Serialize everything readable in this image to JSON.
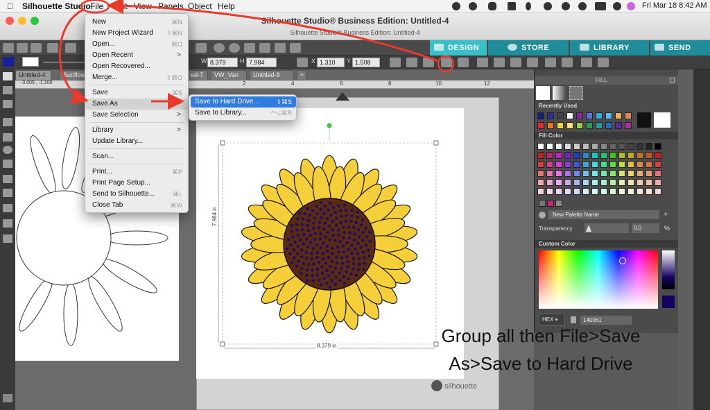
{
  "menubar": {
    "app_name": "Silhouette Studio",
    "items": [
      "File",
      "Edit",
      "View",
      "Panels",
      "Object",
      "Help"
    ],
    "clock": "Fri Mar 18  8:42 AM"
  },
  "window": {
    "title": "Silhouette Studio® Business Edition: Untitled-4",
    "subtitle": "Silhouette Studio® Business Edition: Untitled-4"
  },
  "nav_tabs": [
    {
      "label": "DESIGN",
      "icon": "grid-icon"
    },
    {
      "label": "STORE",
      "icon": "store-icon"
    },
    {
      "label": "LIBRARY",
      "icon": "library-icon"
    },
    {
      "label": "SEND",
      "icon": "send-icon"
    }
  ],
  "toolbar": {
    "w_label": "W",
    "w_value": "8.379",
    "h_label": "H",
    "h_value": "7.984",
    "x_label": "X",
    "x_value": "1.310",
    "y_label": "Y",
    "y_value": "1.508"
  },
  "doc_tabs": [
    "Untitled-4",
    "Sunflow",
    "ed-7",
    "VW_Van",
    "Untitled-8",
    "+"
  ],
  "coords": "-3.005 , -1.100",
  "ruler_marks": [
    "2",
    "4",
    "6",
    "8",
    "10",
    "12"
  ],
  "file_menu": {
    "items": [
      {
        "label": "New",
        "shortcut": "⌘N"
      },
      {
        "label": "New Project Wizard",
        "shortcut": "⇧⌘N"
      },
      {
        "label": "Open...",
        "shortcut": "⌘O"
      },
      {
        "label": "Open Recent",
        "shortcut": ">"
      },
      {
        "label": "Open Recovered...",
        "shortcut": ""
      },
      {
        "label": "Merge...",
        "shortcut": "⇧⌘O"
      },
      {
        "label": "Save",
        "shortcut": "⌘S"
      },
      {
        "label": "Save As",
        "shortcut": ">"
      },
      {
        "label": "Save Selection",
        "shortcut": ">"
      },
      {
        "label": "Library",
        "shortcut": ">"
      },
      {
        "label": "Update Library...",
        "shortcut": ""
      },
      {
        "label": "Scan...",
        "shortcut": ""
      },
      {
        "label": "Print...",
        "shortcut": "⌘P"
      },
      {
        "label": "Print Page Setup...",
        "shortcut": ""
      },
      {
        "label": "Send to Silhouette...",
        "shortcut": "⌘L"
      },
      {
        "label": "Close Tab",
        "shortcut": "⌘W"
      }
    ]
  },
  "save_as_submenu": [
    {
      "label": "Save to Hard Drive...",
      "shortcut": "⇧⌘S"
    },
    {
      "label": "Save to Library...",
      "shortcut": "^⌥⌘R"
    }
  ],
  "panel": {
    "header": "FILL",
    "recently_used": "Recently Used",
    "fill_color": "Fill Color",
    "palette_name": "New Palette Name",
    "transparency_label": "Transparency",
    "transparency_value": "0.0",
    "transparency_unit": "%",
    "custom_color": "Custom Color",
    "hex_label": "HEX",
    "hex_value": "140061",
    "hex_color": "#140061"
  },
  "dimensions": {
    "height": "7.984 in",
    "width": "8.379 in"
  },
  "caption_lines": [
    "Group  all then File>Save",
    "As>Save to Hard Drive"
  ],
  "brand": "silhouette",
  "colors": {
    "annotation_red": "#e8392b",
    "menu_highlight": "#2f7ce0",
    "sunflower_petal": "#f5cf3a",
    "sunflower_center": "#5a2a12",
    "seed_dot": "#1f1060",
    "nav_teal": "#38c0c8"
  }
}
